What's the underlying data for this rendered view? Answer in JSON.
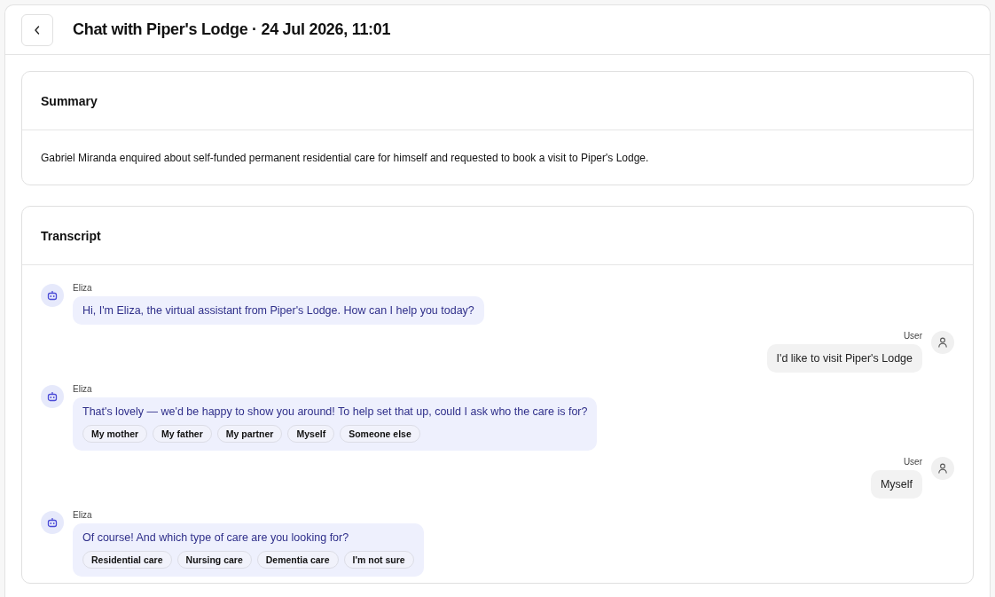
{
  "header": {
    "title": "Chat with Piper's Lodge · 24 Jul 2026, 11:01"
  },
  "summary": {
    "title": "Summary",
    "text": "Gabriel Miranda enquired about self-funded permanent residential care for himself and requested to book a visit to Piper's Lodge."
  },
  "transcript": {
    "title": "Transcript",
    "messages": [
      {
        "kind": "bot",
        "sender": "Eliza",
        "text": "Hi, I'm Eliza, the virtual assistant from Piper's Lodge. How can I help you today?"
      },
      {
        "kind": "user",
        "sender": "User",
        "text": "I'd like to visit Piper's Lodge"
      },
      {
        "kind": "bot",
        "sender": "Eliza",
        "text": "That's lovely — we'd be happy to show you around! To help set that up, could I ask who the care is for?",
        "options": [
          "My mother",
          "My father",
          "My partner",
          "Myself",
          "Someone else"
        ]
      },
      {
        "kind": "user",
        "sender": "User",
        "text": "Myself"
      },
      {
        "kind": "bot",
        "sender": "Eliza",
        "text": "Of course! And which type of care are you looking for?",
        "options": [
          "Residential care",
          "Nursing care",
          "Dementia care",
          "I'm not sure"
        ]
      }
    ]
  }
}
